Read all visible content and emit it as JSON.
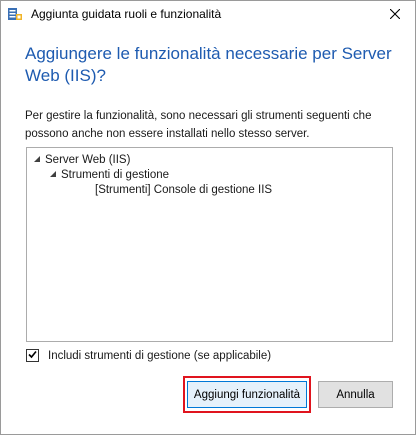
{
  "window": {
    "title": "Aggiunta guidata ruoli e funzionalità",
    "close_symbol": "✕"
  },
  "dialog": {
    "heading": "Aggiungere le funzionalità necessarie per Server Web (IIS)?",
    "description": "Per gestire la funzionalità, sono necessari gli strumenti seguenti che possono anche non essere installati nello stesso server.",
    "tree": [
      {
        "label": "Server Web (IIS)",
        "expanded": true,
        "level": 0
      },
      {
        "label": "Strumenti di gestione",
        "expanded": true,
        "level": 1
      },
      {
        "label": "[Strumenti] Console di gestione IIS",
        "expanded": false,
        "level": 2
      }
    ],
    "checkbox": {
      "label": "Includi strumenti di gestione (se applicabile)",
      "checked": true
    },
    "buttons": {
      "add_features": "Aggiungi funzionalità",
      "cancel": "Annulla"
    }
  },
  "colors": {
    "heading": "#1e5bb0",
    "highlight": "#e0141e",
    "primary_border": "#0078d7"
  },
  "icons": {
    "app": "server-manager-icon",
    "close": "close-icon",
    "expand": "expanded-triangle-icon",
    "check": "checkmark-icon"
  }
}
